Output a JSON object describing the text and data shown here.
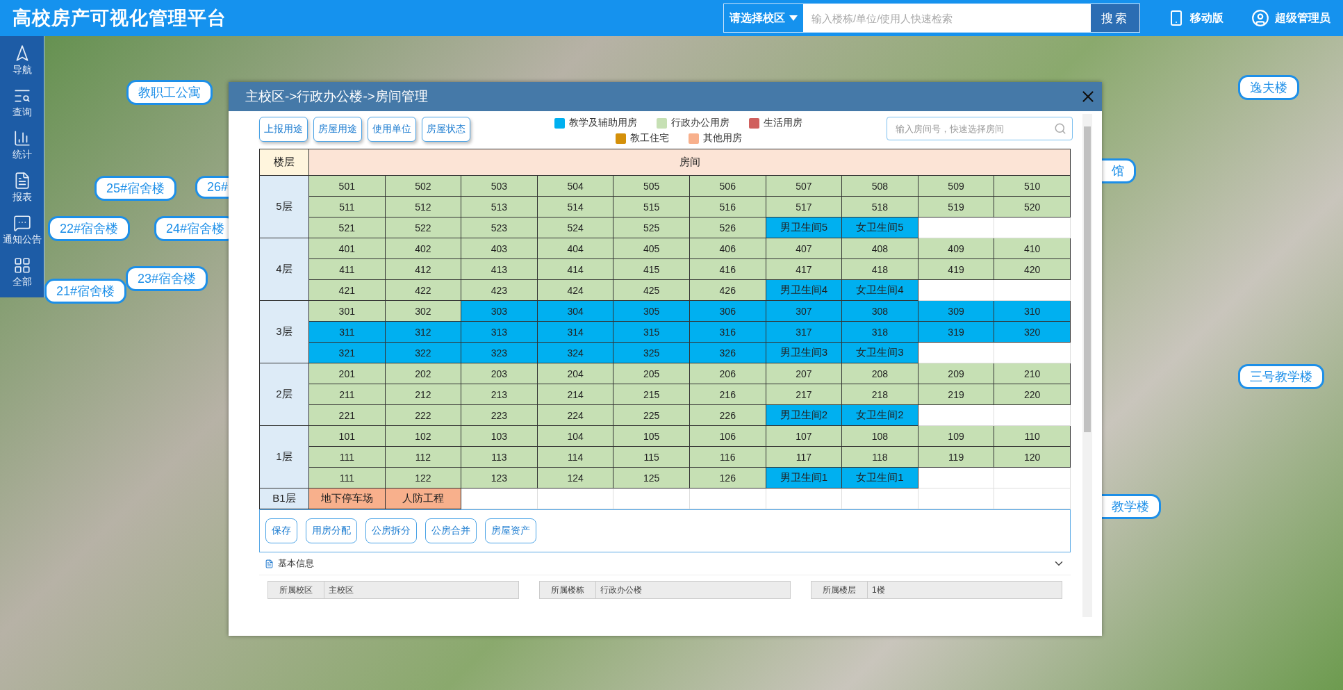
{
  "header": {
    "title": "高校房产可视化管理平台",
    "campus_select": "请选择校区",
    "search": {
      "placeholder": "输入楼栋/单位/使用人快速检索"
    },
    "search_button": "搜索",
    "mobile_link": "移动版",
    "user": "超级管理员"
  },
  "sidebar": {
    "items": [
      {
        "label": "导航",
        "kind": "nav"
      },
      {
        "label": "查询",
        "kind": "query"
      },
      {
        "label": "统计",
        "kind": "stats"
      },
      {
        "label": "报表",
        "kind": "report"
      },
      {
        "label": "通知公告",
        "kind": "notice"
      },
      {
        "label": "全部",
        "kind": "all"
      }
    ]
  },
  "map_labels": [
    {
      "label": "教职工公寓",
      "kind": "full"
    },
    {
      "label": "25#宿舍楼",
      "kind": "full"
    },
    {
      "label": "26#",
      "kind": "cut_right"
    },
    {
      "label": "22#宿舍楼",
      "kind": "full"
    },
    {
      "label": "24#宿舍楼",
      "kind": "full"
    },
    {
      "label": "23#宿舍楼",
      "kind": "full"
    },
    {
      "label": "21#宿舍楼",
      "kind": "full"
    },
    {
      "label": "逸夫楼",
      "kind": "full"
    },
    {
      "label": "馆",
      "kind": "cut_left"
    },
    {
      "label": "三号教学楼",
      "kind": "full"
    },
    {
      "label": "教学楼",
      "kind": "cut_left"
    }
  ],
  "dialog": {
    "breadcrumb": "主校区->行政办公楼->房间管理",
    "filter_buttons": [
      "上报用途",
      "房屋用途",
      "使用单位",
      "房屋状态"
    ],
    "legend": [
      {
        "label": "教学及辅助用房",
        "kind": "teaching",
        "color": "#00b0f0"
      },
      {
        "label": "行政办公用房",
        "kind": "admin",
        "color": "#c6e0b4"
      },
      {
        "label": "生活用房",
        "kind": "living",
        "color": "#d0605e"
      },
      {
        "label": "教工住宅",
        "kind": "staff",
        "color": "#d4900a"
      },
      {
        "label": "其他用房",
        "kind": "other",
        "color": "#f8b08c"
      }
    ],
    "room_search": {
      "placeholder": "输入房间号，快速选择房间"
    },
    "table": {
      "columns": [
        "楼层",
        "房间"
      ],
      "floors": [
        {
          "label": "5层",
          "rows": [
            [
              {
                "label": "501",
                "kind": "admin"
              },
              {
                "label": "502",
                "kind": "admin"
              },
              {
                "label": "503",
                "kind": "admin"
              },
              {
                "label": "504",
                "kind": "admin"
              },
              {
                "label": "505",
                "kind": "admin"
              },
              {
                "label": "506",
                "kind": "admin"
              },
              {
                "label": "507",
                "kind": "admin"
              },
              {
                "label": "508",
                "kind": "admin"
              },
              {
                "label": "509",
                "kind": "admin"
              },
              {
                "label": "510",
                "kind": "admin"
              }
            ],
            [
              {
                "label": "511",
                "kind": "admin"
              },
              {
                "label": "512",
                "kind": "admin"
              },
              {
                "label": "513",
                "kind": "admin"
              },
              {
                "label": "514",
                "kind": "admin"
              },
              {
                "label": "515",
                "kind": "admin"
              },
              {
                "label": "516",
                "kind": "admin"
              },
              {
                "label": "517",
                "kind": "admin"
              },
              {
                "label": "518",
                "kind": "admin"
              },
              {
                "label": "519",
                "kind": "admin"
              },
              {
                "label": "520",
                "kind": "admin"
              }
            ],
            [
              {
                "label": "521",
                "kind": "admin"
              },
              {
                "label": "522",
                "kind": "admin"
              },
              {
                "label": "523",
                "kind": "admin"
              },
              {
                "label": "524",
                "kind": "admin"
              },
              {
                "label": "525",
                "kind": "admin"
              },
              {
                "label": "526",
                "kind": "admin"
              },
              {
                "label": "男卫生间5",
                "kind": "teaching"
              },
              {
                "label": "女卫生间5",
                "kind": "teaching"
              }
            ]
          ]
        },
        {
          "label": "4层",
          "rows": [
            [
              {
                "label": "401",
                "kind": "admin"
              },
              {
                "label": "402",
                "kind": "admin"
              },
              {
                "label": "403",
                "kind": "admin"
              },
              {
                "label": "404",
                "kind": "admin"
              },
              {
                "label": "405",
                "kind": "admin"
              },
              {
                "label": "406",
                "kind": "admin"
              },
              {
                "label": "407",
                "kind": "admin"
              },
              {
                "label": "408",
                "kind": "admin"
              },
              {
                "label": "409",
                "kind": "admin"
              },
              {
                "label": "410",
                "kind": "admin"
              }
            ],
            [
              {
                "label": "411",
                "kind": "admin"
              },
              {
                "label": "412",
                "kind": "admin"
              },
              {
                "label": "413",
                "kind": "admin"
              },
              {
                "label": "414",
                "kind": "admin"
              },
              {
                "label": "415",
                "kind": "admin"
              },
              {
                "label": "416",
                "kind": "admin"
              },
              {
                "label": "417",
                "kind": "admin"
              },
              {
                "label": "418",
                "kind": "admin"
              },
              {
                "label": "419",
                "kind": "admin"
              },
              {
                "label": "420",
                "kind": "admin"
              }
            ],
            [
              {
                "label": "421",
                "kind": "admin"
              },
              {
                "label": "422",
                "kind": "admin"
              },
              {
                "label": "423",
                "kind": "admin"
              },
              {
                "label": "424",
                "kind": "admin"
              },
              {
                "label": "425",
                "kind": "admin"
              },
              {
                "label": "426",
                "kind": "admin"
              },
              {
                "label": "男卫生间4",
                "kind": "teaching"
              },
              {
                "label": "女卫生间4",
                "kind": "teaching"
              }
            ]
          ]
        },
        {
          "label": "3层",
          "rows": [
            [
              {
                "label": "301",
                "kind": "admin"
              },
              {
                "label": "302",
                "kind": "admin"
              },
              {
                "label": "303",
                "kind": "teaching"
              },
              {
                "label": "304",
                "kind": "teaching"
              },
              {
                "label": "305",
                "kind": "teaching"
              },
              {
                "label": "306",
                "kind": "teaching"
              },
              {
                "label": "307",
                "kind": "teaching"
              },
              {
                "label": "308",
                "kind": "teaching"
              },
              {
                "label": "309",
                "kind": "teaching"
              },
              {
                "label": "310",
                "kind": "teaching"
              }
            ],
            [
              {
                "label": "311",
                "kind": "teaching"
              },
              {
                "label": "312",
                "kind": "teaching"
              },
              {
                "label": "313",
                "kind": "teaching"
              },
              {
                "label": "314",
                "kind": "teaching"
              },
              {
                "label": "315",
                "kind": "teaching"
              },
              {
                "label": "316",
                "kind": "teaching"
              },
              {
                "label": "317",
                "kind": "teaching"
              },
              {
                "label": "318",
                "kind": "teaching"
              },
              {
                "label": "319",
                "kind": "teaching"
              },
              {
                "label": "320",
                "kind": "teaching"
              }
            ],
            [
              {
                "label": "321",
                "kind": "teaching"
              },
              {
                "label": "322",
                "kind": "teaching"
              },
              {
                "label": "323",
                "kind": "teaching"
              },
              {
                "label": "324",
                "kind": "teaching"
              },
              {
                "label": "325",
                "kind": "teaching"
              },
              {
                "label": "326",
                "kind": "teaching"
              },
              {
                "label": "男卫生间3",
                "kind": "teaching"
              },
              {
                "label": "女卫生间3",
                "kind": "teaching"
              }
            ]
          ]
        },
        {
          "label": "2层",
          "rows": [
            [
              {
                "label": "201",
                "kind": "admin"
              },
              {
                "label": "202",
                "kind": "admin"
              },
              {
                "label": "203",
                "kind": "admin"
              },
              {
                "label": "204",
                "kind": "admin"
              },
              {
                "label": "205",
                "kind": "admin"
              },
              {
                "label": "206",
                "kind": "admin"
              },
              {
                "label": "207",
                "kind": "admin"
              },
              {
                "label": "208",
                "kind": "admin"
              },
              {
                "label": "209",
                "kind": "admin"
              },
              {
                "label": "210",
                "kind": "admin"
              }
            ],
            [
              {
                "label": "211",
                "kind": "admin"
              },
              {
                "label": "212",
                "kind": "admin"
              },
              {
                "label": "213",
                "kind": "admin"
              },
              {
                "label": "214",
                "kind": "admin"
              },
              {
                "label": "215",
                "kind": "admin"
              },
              {
                "label": "216",
                "kind": "admin"
              },
              {
                "label": "217",
                "kind": "admin"
              },
              {
                "label": "218",
                "kind": "admin"
              },
              {
                "label": "219",
                "kind": "admin"
              },
              {
                "label": "220",
                "kind": "admin"
              }
            ],
            [
              {
                "label": "221",
                "kind": "admin"
              },
              {
                "label": "222",
                "kind": "admin"
              },
              {
                "label": "223",
                "kind": "admin"
              },
              {
                "label": "224",
                "kind": "admin"
              },
              {
                "label": "225",
                "kind": "admin"
              },
              {
                "label": "226",
                "kind": "admin"
              },
              {
                "label": "男卫生间2",
                "kind": "teaching"
              },
              {
                "label": "女卫生间2",
                "kind": "teaching"
              }
            ]
          ]
        },
        {
          "label": "1层",
          "rows": [
            [
              {
                "label": "101",
                "kind": "admin"
              },
              {
                "label": "102",
                "kind": "admin"
              },
              {
                "label": "103",
                "kind": "admin"
              },
              {
                "label": "104",
                "kind": "admin"
              },
              {
                "label": "105",
                "kind": "admin"
              },
              {
                "label": "106",
                "kind": "admin"
              },
              {
                "label": "107",
                "kind": "admin"
              },
              {
                "label": "108",
                "kind": "admin"
              },
              {
                "label": "109",
                "kind": "admin"
              },
              {
                "label": "110",
                "kind": "admin"
              }
            ],
            [
              {
                "label": "111",
                "kind": "admin"
              },
              {
                "label": "112",
                "kind": "admin"
              },
              {
                "label": "113",
                "kind": "admin"
              },
              {
                "label": "114",
                "kind": "admin"
              },
              {
                "label": "115",
                "kind": "admin"
              },
              {
                "label": "116",
                "kind": "admin"
              },
              {
                "label": "117",
                "kind": "admin"
              },
              {
                "label": "118",
                "kind": "admin"
              },
              {
                "label": "119",
                "kind": "admin"
              },
              {
                "label": "120",
                "kind": "admin"
              }
            ],
            [
              {
                "label": "111",
                "kind": "admin"
              },
              {
                "label": "122",
                "kind": "admin"
              },
              {
                "label": "123",
                "kind": "admin"
              },
              {
                "label": "124",
                "kind": "admin"
              },
              {
                "label": "125",
                "kind": "admin"
              },
              {
                "label": "126",
                "kind": "admin"
              },
              {
                "label": "男卫生间1",
                "kind": "teaching"
              },
              {
                "label": "女卫生间1",
                "kind": "teaching"
              }
            ]
          ]
        },
        {
          "label": "B1层",
          "rows": [
            [
              {
                "label": "地下停车场",
                "kind": "other"
              },
              {
                "label": "人防工程",
                "kind": "other"
              }
            ]
          ]
        }
      ]
    },
    "action_buttons": [
      "保存",
      "用房分配",
      "公房拆分",
      "公房合并",
      "房屋资产"
    ],
    "info": {
      "title": "基本信息",
      "expanded": true,
      "fields": [
        {
          "label": "所属校区",
          "value": "主校区"
        },
        {
          "label": "所属楼栋",
          "value": "行政办公楼"
        },
        {
          "label": "所属楼层",
          "value": "1楼"
        }
      ]
    }
  }
}
